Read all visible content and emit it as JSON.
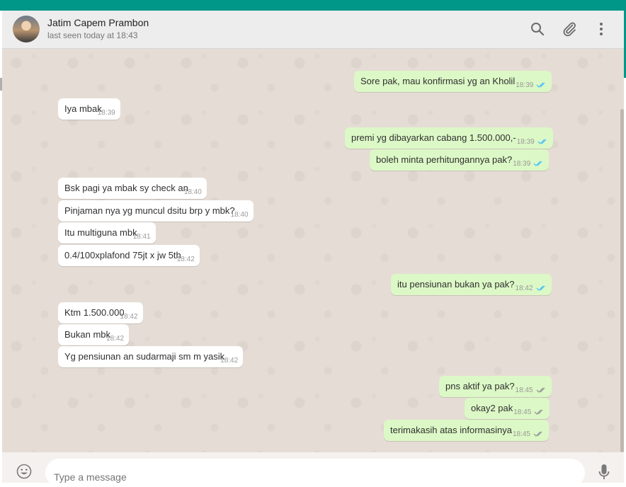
{
  "header": {
    "contact_name": "Jatim Capem Prambon",
    "last_seen": "last seen today at 18:43",
    "icons": [
      "search-icon",
      "attach-icon",
      "menu-icon"
    ]
  },
  "messages": [
    {
      "dir": "out",
      "text": "Sore pak, mau konfirmasi yg an Kholil",
      "time": "18:39",
      "status": "read"
    },
    {
      "dir": "in",
      "text": "Iya mbak",
      "time": "18:39"
    },
    {
      "dir": "out",
      "text": "premi yg dibayarkan cabang 1.500.000,-",
      "time": "18:39",
      "status": "read"
    },
    {
      "dir": "out",
      "text": "boleh minta perhitungannya pak?",
      "time": "18:39",
      "status": "read"
    },
    {
      "dir": "in",
      "text": "Bsk pagi ya mbak sy check an",
      "time": "18:40"
    },
    {
      "dir": "in",
      "text": "Pinjaman nya yg muncul dsitu brp y mbk?",
      "time": "18:40"
    },
    {
      "dir": "in",
      "text": "Itu multiguna mbk",
      "time": "18:41"
    },
    {
      "dir": "in",
      "text": "0.4/100xplafond 75jt x jw 5th",
      "time": "18:42"
    },
    {
      "dir": "out",
      "text": "itu pensiunan bukan ya pak?",
      "time": "18:42",
      "status": "read"
    },
    {
      "dir": "in",
      "text": "Ktm 1.500.000",
      "time": "18:42"
    },
    {
      "dir": "in",
      "text": "Bukan mbk",
      "time": "18:42"
    },
    {
      "dir": "in",
      "text": "Yg pensiunan an sudarmaji sm m yasik",
      "time": "18:42"
    },
    {
      "dir": "out",
      "text": "pns aktif ya pak?",
      "time": "18:45",
      "status": "delivered"
    },
    {
      "dir": "out",
      "text": "okay2 pak",
      "time": "18:45",
      "status": "delivered"
    },
    {
      "dir": "out",
      "text": "terimakasih atas informasinya",
      "time": "18:45",
      "status": "delivered"
    }
  ],
  "composer": {
    "placeholder": "Type a message"
  },
  "colors": {
    "accent": "#009688",
    "outgoing_bubble": "#dcf8c6",
    "incoming_bubble": "#ffffff",
    "chat_background": "#e5ddd5",
    "read_check": "#4fc3f7",
    "delivered_check": "#999999"
  }
}
